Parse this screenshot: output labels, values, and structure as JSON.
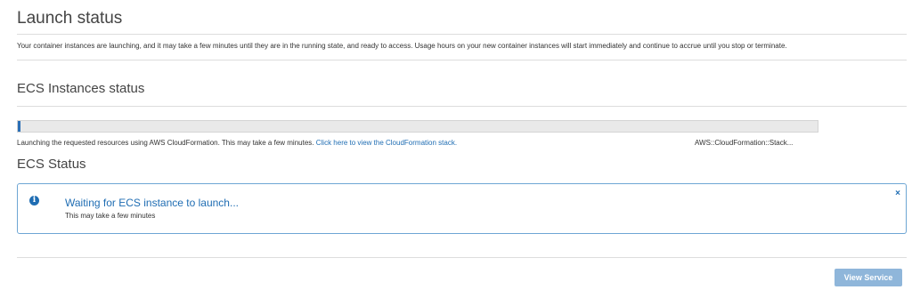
{
  "page": {
    "title": "Launch status",
    "intro": "Your container instances are launching, and it may take a few minutes until they are in the running state, and ready to access. Usage hours on your new container instances will start immediately and continue to accrue until you stop or terminate."
  },
  "ecs_instances": {
    "heading": "ECS Instances status",
    "progress_fraction": 0.003,
    "message": "Launching the requested resources using AWS CloudFormation. This may take a few minutes.",
    "link_text": "Click here to view the CloudFormation stack.",
    "resource_type": "AWS::CloudFormation::Stack..."
  },
  "ecs_status": {
    "heading": "ECS Status",
    "alert_title": "Waiting for ECS instance to launch...",
    "alert_subtitle": "This may take a few minutes",
    "close_glyph": "×"
  },
  "footer": {
    "view_service_label": "View Service"
  },
  "colors": {
    "accent": "#1f6db3",
    "button_disabled": "#8fb6da",
    "alert_border": "#6ea6d4"
  }
}
